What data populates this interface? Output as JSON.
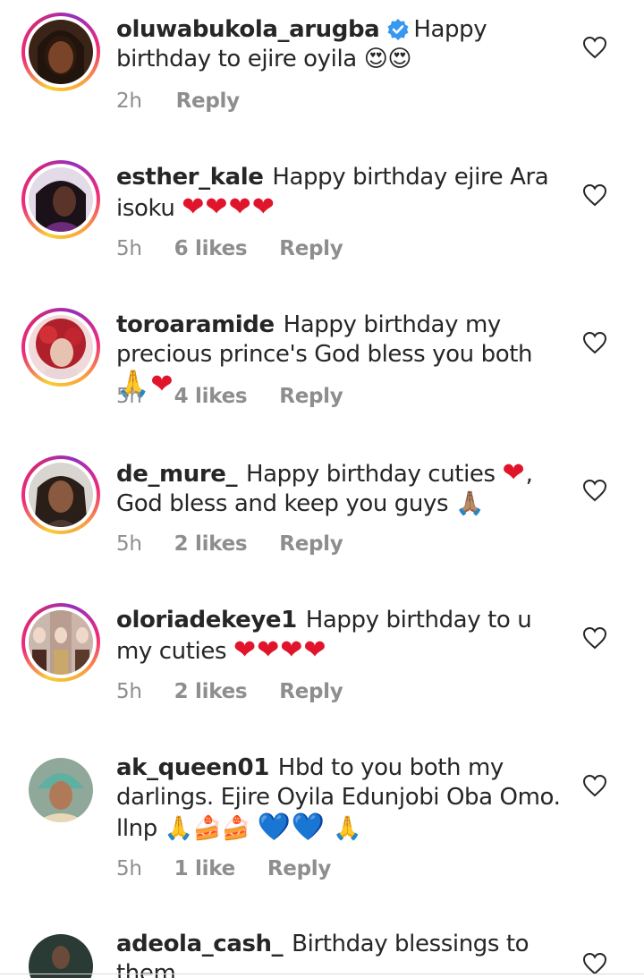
{
  "comments": [
    {
      "username": "oluwabukola_arugba",
      "verified": true,
      "text": "Happy birthday to ejire oyila",
      "emoji": "😍😍",
      "time": "2h",
      "likes": "",
      "reply": "Reply"
    },
    {
      "username": "esther_kale",
      "text": "Happy birthday ejire Ara isoku",
      "emoji": "❤❤❤❤",
      "time": "5h",
      "likes": "6 likes",
      "reply": "Reply"
    },
    {
      "username": "toroaramide",
      "text": "Happy birthday my precious prince's God bless you both",
      "emoji": "🙏❤",
      "time": "5h",
      "likes": "4 likes",
      "reply": "Reply"
    },
    {
      "username": "de_mure_",
      "text_a": "Happy birthday cuties",
      "emoji_a": "❤",
      "text_b": ", God bless and keep you guys",
      "emoji_b": "🙏🏽",
      "time": "5h",
      "likes": "2 likes",
      "reply": "Reply"
    },
    {
      "username": "oloriadekeye1",
      "text": "Happy birthday to u my cuties",
      "emoji": "❤❤❤❤",
      "time": "5h",
      "likes": "2 likes",
      "reply": "Reply"
    },
    {
      "username": "ak_queen01",
      "text": "Hbd to you both my darlings. Ejire Oyila Edunjobi Oba Omo. llnp",
      "emoji_a": "🙏🍰🍰",
      "emoji_b": "💙💙",
      "emoji_c": "🙏",
      "time": "5h",
      "likes": "1 like",
      "reply": "Reply"
    },
    {
      "username": "adeola_cash_",
      "text": "Birthday blessings to them"
    }
  ],
  "colors": {
    "text": "#262626",
    "meta": "#8e8e8e",
    "verified": "#3897f0",
    "red_heart": "#e0152c",
    "blue_heart": "#1c8de8"
  },
  "icons": {
    "like": "heart-outline-icon",
    "verified": "verified-badge-icon"
  }
}
